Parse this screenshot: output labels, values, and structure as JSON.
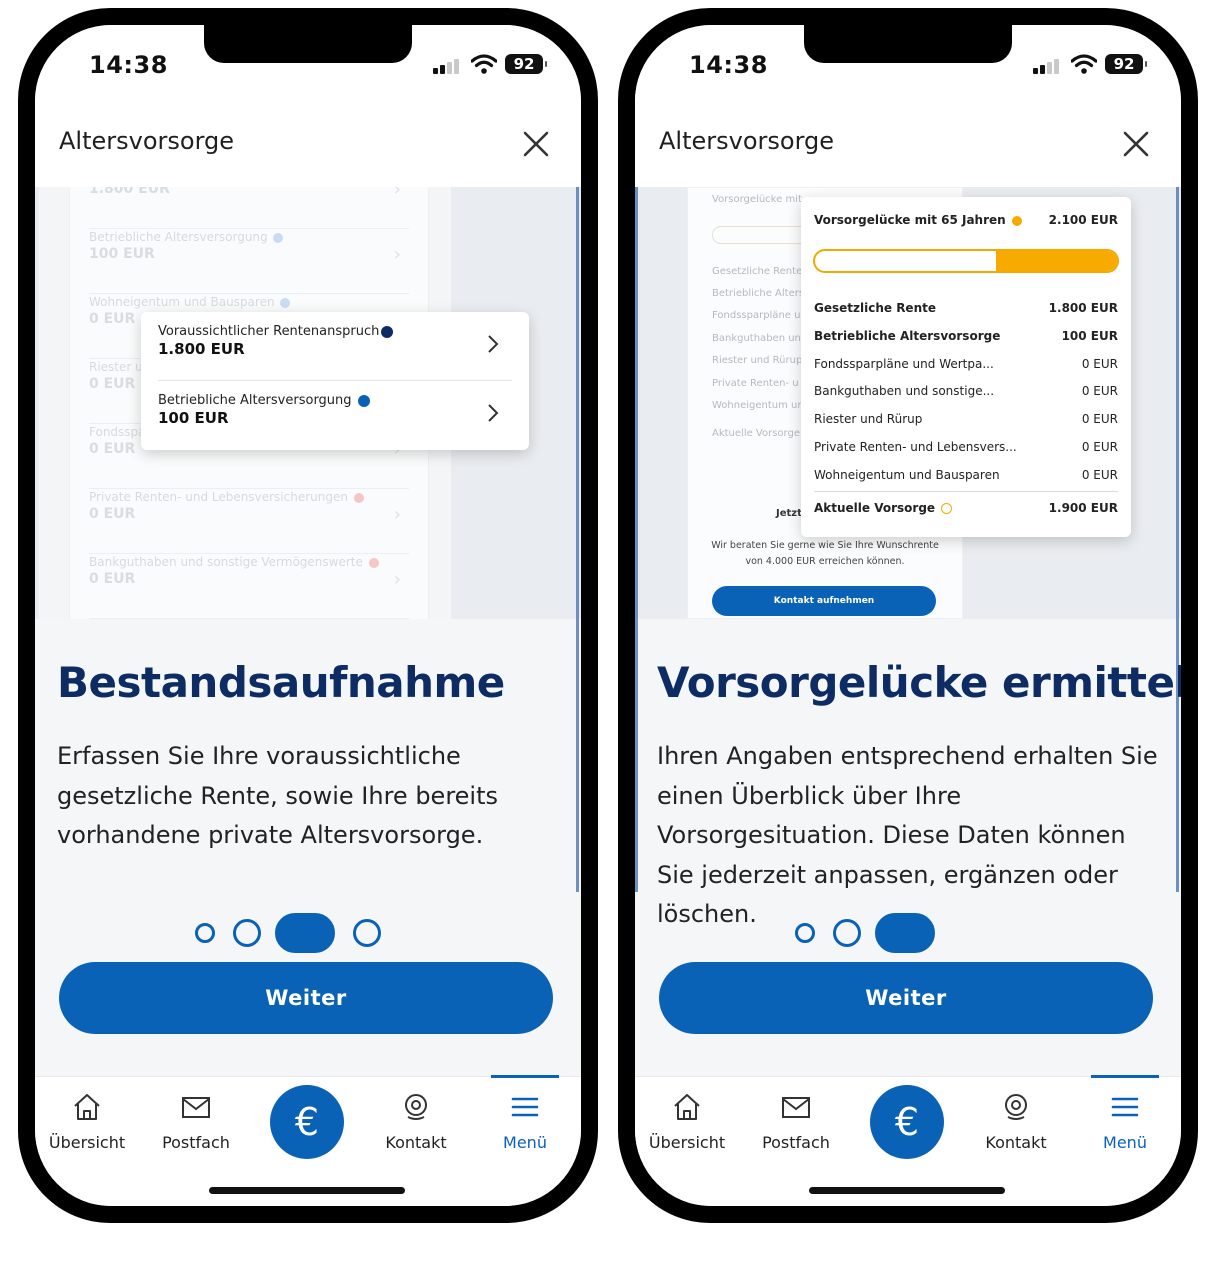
{
  "status": {
    "time": "14:38",
    "battery": "92"
  },
  "appbar": {
    "title": "Altersvorsorge"
  },
  "left": {
    "bg_rows": [
      {
        "label": "",
        "value": "1.800 EUR",
        "dot": "#c8dcf3"
      },
      {
        "label": "Betriebliche Altersversorgung",
        "value": "100 EUR",
        "dot": "#c8dcf3"
      },
      {
        "label": "Wohneigentum und Bausparen",
        "value": "0 EUR",
        "dot": "#c8dcf3"
      },
      {
        "label": "Riester und Rürup",
        "value": "0 EUR",
        "dot": "#c8dcf3"
      },
      {
        "label": "Fondssparpläne und Wertpapiere",
        "value": "0 EUR",
        "dot": "#c8dcf3"
      },
      {
        "label": "Private Renten- und Lebensversicherungen",
        "value": "0 EUR",
        "dot": "#f5c6c6"
      },
      {
        "label": "Bankguthaben und sonstige Vermögenswerte",
        "value": "0 EUR",
        "dot": "#f5c6c6"
      }
    ],
    "popup": [
      {
        "label": "Voraussichtlicher Rentenanspruch",
        "value": "1.800 EUR",
        "dot": "#0d2c64"
      },
      {
        "label": "Betriebliche Altersversorgung",
        "value": "100 EUR",
        "dot": "#0a62b6"
      }
    ],
    "headline": "Bestandsaufnahme",
    "body": "Erfassen Sie Ihre voraussichtliche gesetzliche Rente, sowie Ihre bereits vorhandene private Altersvorsorge.",
    "pager_active": 3,
    "pager_count": 4
  },
  "right": {
    "bg_rows": [
      "Vorsorgelücke mit",
      "Gesetzliche Rente",
      "Betriebliche Alters",
      "Fondssparpläne u",
      "Bankguthaben un",
      "Riester und Rürup",
      "Private Renten- u",
      "Wohneigentum un",
      "Aktuelle Vorsorge"
    ],
    "bg_contact_title": "Jetzt",
    "bg_contact_text_1": "Wir beraten Sie gerne wie Sie Ihre Wunschrente",
    "bg_contact_text_2": "von 4.000 EUR erreichen können.",
    "bg_contact_button": "Kontakt aufnehmen",
    "gap": {
      "title": "Vorsorgelücke mit 65 Jahren",
      "title_value": "2.100 EUR",
      "bar_gap_fraction": 0.4,
      "rows": [
        {
          "label": "Gesetzliche Rente",
          "value": "1.800 EUR",
          "bold": true
        },
        {
          "label": "Betriebliche Altersvorsorge",
          "value": "100 EUR",
          "bold": true
        },
        {
          "label": "Fondssparpläne und Wertpa...",
          "value": "0 EUR",
          "bold": false
        },
        {
          "label": "Bankguthaben und sonstige...",
          "value": "0 EUR",
          "bold": false
        },
        {
          "label": "Riester und Rürup",
          "value": "0 EUR",
          "bold": false
        },
        {
          "label": "Private Renten- und Lebensvers...",
          "value": "0 EUR",
          "bold": false
        },
        {
          "label": "Wohneigentum und Bausparen",
          "value": "0 EUR",
          "bold": false
        }
      ],
      "total_label": "Aktuelle Vorsorge",
      "total_value": "1.900 EUR"
    },
    "headline": "Vorsorgelücke ermitteln",
    "body": "Ihren Angaben entsprechend erhalten Sie einen Überblick über Ihre Vorsorgesituation. Diese Daten können Sie jederzeit anpassen, ergänzen oder löschen.",
    "pager_active": 3,
    "pager_count": 3
  },
  "cta": {
    "label": "Weiter"
  },
  "tabs": {
    "overview": "Übersicht",
    "inbox": "Postfach",
    "euro": "€",
    "contact": "Kontakt",
    "menu": "Menü"
  },
  "colors": {
    "brand": "#0a62b6",
    "navy": "#0d2c64",
    "gap_yellow": "#f7ab00"
  }
}
